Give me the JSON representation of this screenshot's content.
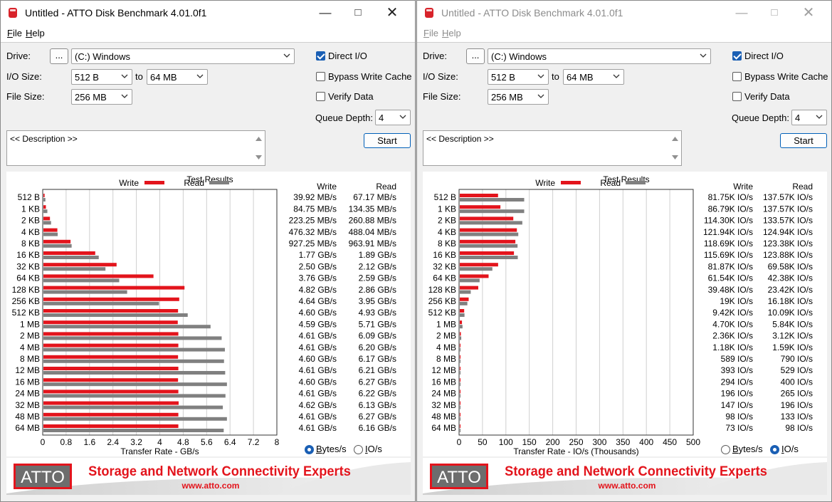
{
  "common": {
    "menu": [
      "File",
      "Help"
    ],
    "labels": {
      "drive": "Drive:",
      "io_size": "I/O Size:",
      "file_size": "File Size:",
      "to": "to",
      "queue_depth": "Queue Depth:"
    },
    "browse": "...",
    "drive_value": "(C:) Windows",
    "io_from": "512 B",
    "io_to": "64 MB",
    "file_size_value": "256 MB",
    "queue_value": "4",
    "direct_io": "Direct I/O",
    "bypass_write_cache": "Bypass Write Cache",
    "verify_data": "Verify Data",
    "start": "Start",
    "description": "<< Description >>",
    "results_title": "Test Results",
    "legend_write": "Write",
    "legend_read": "Read",
    "col_write": "Write",
    "col_read": "Read",
    "radio_bytes": "Bytes/s",
    "radio_io": "IO/s",
    "banner_slogan": "Storage and Network Connectivity Experts",
    "banner_url": "www.atto.com",
    "logo_text": "ATTO",
    "colors": {
      "write": "#e3141c",
      "read": "#808080",
      "banner_red": "#e3141c"
    }
  },
  "windows": [
    {
      "title": "Untitled - ATTO Disk Benchmark 4.01.0f1",
      "active": true,
      "selected_radio": "bytes",
      "chart_data": {
        "type": "bar",
        "orientation": "horizontal",
        "title": "Test Results",
        "xlabel": "Transfer Rate - GB/s",
        "xlim": [
          0,
          8
        ],
        "xticks": [
          "0",
          "0.8",
          "1.6",
          "2.4",
          "3.2",
          "4",
          "4.8",
          "5.6",
          "6.4",
          "7.2",
          "8"
        ],
        "categories": [
          "512 B",
          "1 KB",
          "2 KB",
          "4 KB",
          "8 KB",
          "16 KB",
          "32 KB",
          "64 KB",
          "128 KB",
          "256 KB",
          "512 KB",
          "1 MB",
          "2 MB",
          "4 MB",
          "8 MB",
          "12 MB",
          "16 MB",
          "24 MB",
          "32 MB",
          "48 MB",
          "64 MB"
        ],
        "series": [
          {
            "name": "Write",
            "values": [
              0.0399,
              0.0848,
              0.2233,
              0.4763,
              0.9273,
              1.77,
              2.5,
              3.76,
              4.82,
              4.64,
              4.6,
              4.59,
              4.61,
              4.61,
              4.6,
              4.61,
              4.6,
              4.61,
              4.62,
              4.61,
              4.61
            ]
          },
          {
            "name": "Read",
            "values": [
              0.0672,
              0.1344,
              0.2609,
              0.488,
              0.9639,
              1.89,
              2.12,
              2.59,
              2.86,
              3.95,
              4.93,
              5.71,
              6.09,
              6.2,
              6.17,
              6.21,
              6.27,
              6.22,
              6.13,
              6.27,
              6.16
            ]
          }
        ],
        "write_labels": [
          "39.92 MB/s",
          "84.75 MB/s",
          "223.25 MB/s",
          "476.32 MB/s",
          "927.25 MB/s",
          "1.77 GB/s",
          "2.50 GB/s",
          "3.76 GB/s",
          "4.82 GB/s",
          "4.64 GB/s",
          "4.60 GB/s",
          "4.59 GB/s",
          "4.61 GB/s",
          "4.61 GB/s",
          "4.60 GB/s",
          "4.61 GB/s",
          "4.60 GB/s",
          "4.61 GB/s",
          "4.62 GB/s",
          "4.61 GB/s",
          "4.61 GB/s"
        ],
        "read_labels": [
          "67.17 MB/s",
          "134.35 MB/s",
          "260.88 MB/s",
          "488.04 MB/s",
          "963.91 MB/s",
          "1.89 GB/s",
          "2.12 GB/s",
          "2.59 GB/s",
          "2.86 GB/s",
          "3.95 GB/s",
          "4.93 GB/s",
          "5.71 GB/s",
          "6.09 GB/s",
          "6.20 GB/s",
          "6.17 GB/s",
          "6.21 GB/s",
          "6.27 GB/s",
          "6.22 GB/s",
          "6.13 GB/s",
          "6.27 GB/s",
          "6.16 GB/s"
        ]
      }
    },
    {
      "title": "Untitled - ATTO Disk Benchmark 4.01.0f1",
      "active": false,
      "selected_radio": "io",
      "chart_data": {
        "type": "bar",
        "orientation": "horizontal",
        "title": "Test Results",
        "xlabel": "Transfer Rate - IO/s (Thousands)",
        "xlim": [
          0,
          500
        ],
        "xticks": [
          "0",
          "50",
          "100",
          "150",
          "200",
          "250",
          "300",
          "350",
          "400",
          "450",
          "500"
        ],
        "categories": [
          "512 B",
          "1 KB",
          "2 KB",
          "4 KB",
          "8 KB",
          "16 KB",
          "32 KB",
          "64 KB",
          "128 KB",
          "256 KB",
          "512 KB",
          "1 MB",
          "2 MB",
          "4 MB",
          "8 MB",
          "12 MB",
          "16 MB",
          "24 MB",
          "32 MB",
          "48 MB",
          "64 MB"
        ],
        "series": [
          {
            "name": "Write",
            "values": [
              81.75,
              86.79,
              114.3,
              121.94,
              118.69,
              115.69,
              81.87,
              61.54,
              39.48,
              19.0,
              9.42,
              4.7,
              2.36,
              1.18,
              0.589,
              0.393,
              0.294,
              0.196,
              0.147,
              0.098,
              0.073
            ]
          },
          {
            "name": "Read",
            "values": [
              137.57,
              137.57,
              133.57,
              124.94,
              123.38,
              123.88,
              69.58,
              42.38,
              23.42,
              16.18,
              10.09,
              5.84,
              3.12,
              1.59,
              0.79,
              0.529,
              0.4,
              0.265,
              0.196,
              0.133,
              0.098
            ]
          }
        ],
        "write_labels": [
          "81.75K IO/s",
          "86.79K IO/s",
          "114.30K IO/s",
          "121.94K IO/s",
          "118.69K IO/s",
          "115.69K IO/s",
          "81.87K IO/s",
          "61.54K IO/s",
          "39.48K IO/s",
          "19K IO/s",
          "9.42K IO/s",
          "4.70K IO/s",
          "2.36K IO/s",
          "1.18K IO/s",
          "589 IO/s",
          "393 IO/s",
          "294 IO/s",
          "196 IO/s",
          "147 IO/s",
          "98 IO/s",
          "73 IO/s"
        ],
        "read_labels": [
          "137.57K IO/s",
          "137.57K IO/s",
          "133.57K IO/s",
          "124.94K IO/s",
          "123.38K IO/s",
          "123.88K IO/s",
          "69.58K IO/s",
          "42.38K IO/s",
          "23.42K IO/s",
          "16.18K IO/s",
          "10.09K IO/s",
          "5.84K IO/s",
          "3.12K IO/s",
          "1.59K IO/s",
          "790 IO/s",
          "529 IO/s",
          "400 IO/s",
          "265 IO/s",
          "196 IO/s",
          "133 IO/s",
          "98 IO/s"
        ]
      }
    }
  ]
}
